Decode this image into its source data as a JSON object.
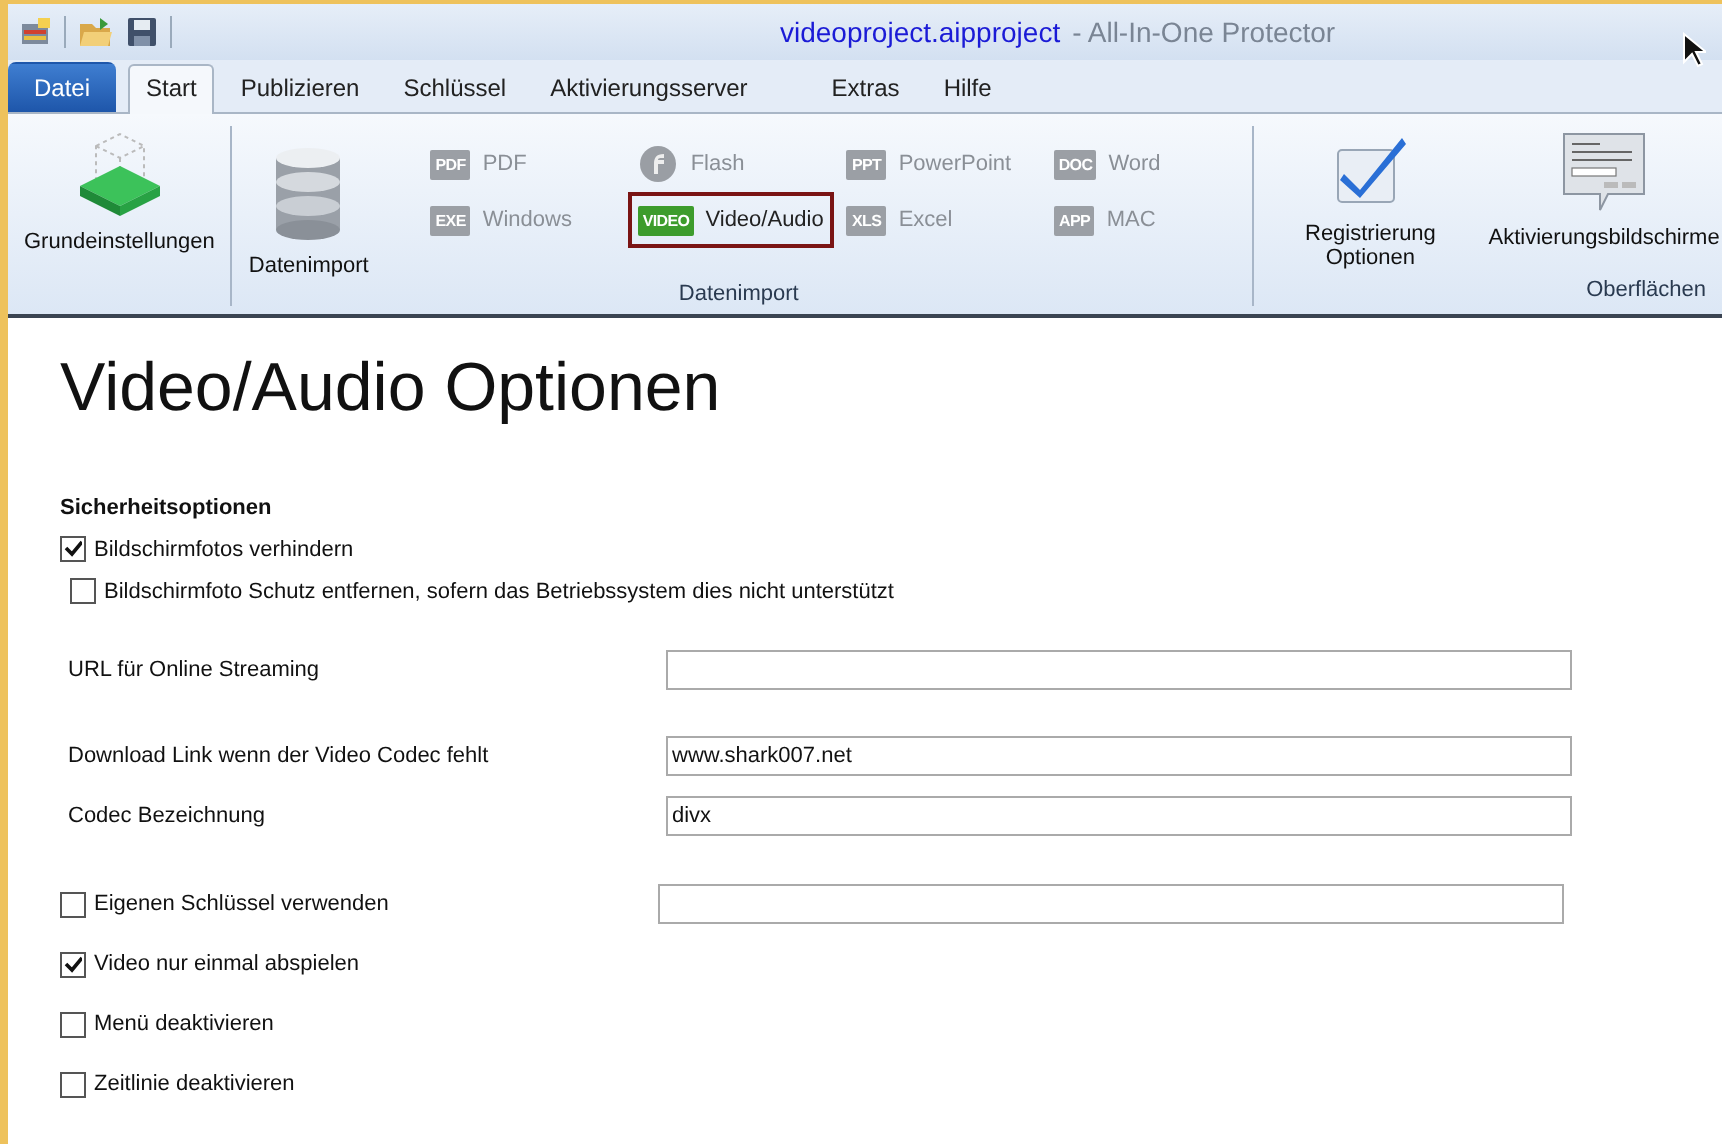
{
  "window": {
    "title": "videoproject.aipproject",
    "app_name": "- All-In-One Protector"
  },
  "tabs": [
    {
      "label": "Datei",
      "kind": "file",
      "selected": false
    },
    {
      "label": "Start",
      "kind": "tab",
      "selected": true
    },
    {
      "label": "Publizieren",
      "kind": "tab",
      "selected": false
    },
    {
      "label": "Schlüssel",
      "kind": "tab",
      "selected": false
    },
    {
      "label": "Aktivierungsserver",
      "kind": "tab",
      "selected": false
    },
    {
      "label": "Extras",
      "kind": "tab",
      "selected": false
    },
    {
      "label": "Hilfe",
      "kind": "tab",
      "selected": false
    }
  ],
  "ribbon": {
    "groups": [
      {
        "items": [
          {
            "kind": "large",
            "label": "Grundeinstellungen"
          }
        ]
      },
      {
        "label": "Datenimport",
        "items": [
          {
            "kind": "large",
            "label": "Datenimport"
          },
          {
            "kind": "small",
            "badge": "PDF",
            "label": "PDF",
            "disabled": true,
            "selected": false
          },
          {
            "kind": "small",
            "badge": "EXE",
            "label": "Windows",
            "disabled": true,
            "selected": false
          },
          {
            "kind": "small",
            "label": "Flash",
            "disabled": true,
            "selected": false
          },
          {
            "kind": "small",
            "badge": "VIDEO",
            "label": "Video/Audio",
            "disabled": false,
            "selected": true
          },
          {
            "kind": "small",
            "badge": "PPT",
            "label": "PowerPoint",
            "disabled": true,
            "selected": false
          },
          {
            "kind": "small",
            "badge": "XLS",
            "label": "Excel",
            "disabled": true,
            "selected": false
          },
          {
            "kind": "small",
            "badge": "DOC",
            "label": "Word",
            "disabled": true,
            "selected": false
          },
          {
            "kind": "small",
            "badge": "APP",
            "label": "MAC",
            "disabled": true,
            "selected": false
          }
        ]
      },
      {
        "label": "Oberflächen",
        "items": [
          {
            "kind": "large",
            "label": "Registrierung Optionen"
          },
          {
            "kind": "large",
            "label": "Aktivierungsbildschirme"
          }
        ]
      }
    ]
  },
  "page": {
    "title": "Video/Audio Optionen",
    "sections": [
      {
        "heading": "Sicherheitsoptionen",
        "items": [
          {
            "kind": "checkbox",
            "label": "Bildschirmfotos verhindern",
            "checked": true
          },
          {
            "kind": "checkbox",
            "label": "Bildschirmfoto Schutz entfernen, sofern das Betriebssystem dies nicht unterstützt",
            "checked": false
          }
        ]
      },
      {
        "items": [
          {
            "kind": "field",
            "label": "URL für Online Streaming"
          }
        ]
      },
      {
        "items": [
          {
            "kind": "field",
            "label": "Download Link wenn der Video Codec fehlt",
            "value": "www.shark007.net"
          },
          {
            "kind": "field",
            "label": "Codec Bezeichnung",
            "value": "divx"
          }
        ]
      },
      {
        "items": [
          {
            "kind": "checkbox_field",
            "label": "Eigenen Schlüssel verwenden",
            "checked": false
          },
          {
            "kind": "checkbox",
            "label": "Video nur einmal abspielen",
            "checked": true
          },
          {
            "kind": "checkbox",
            "label": "Menü deaktivieren",
            "checked": false
          },
          {
            "kind": "checkbox",
            "label": "Zeitlinie deaktivieren",
            "checked": false
          }
        ]
      }
    ]
  }
}
